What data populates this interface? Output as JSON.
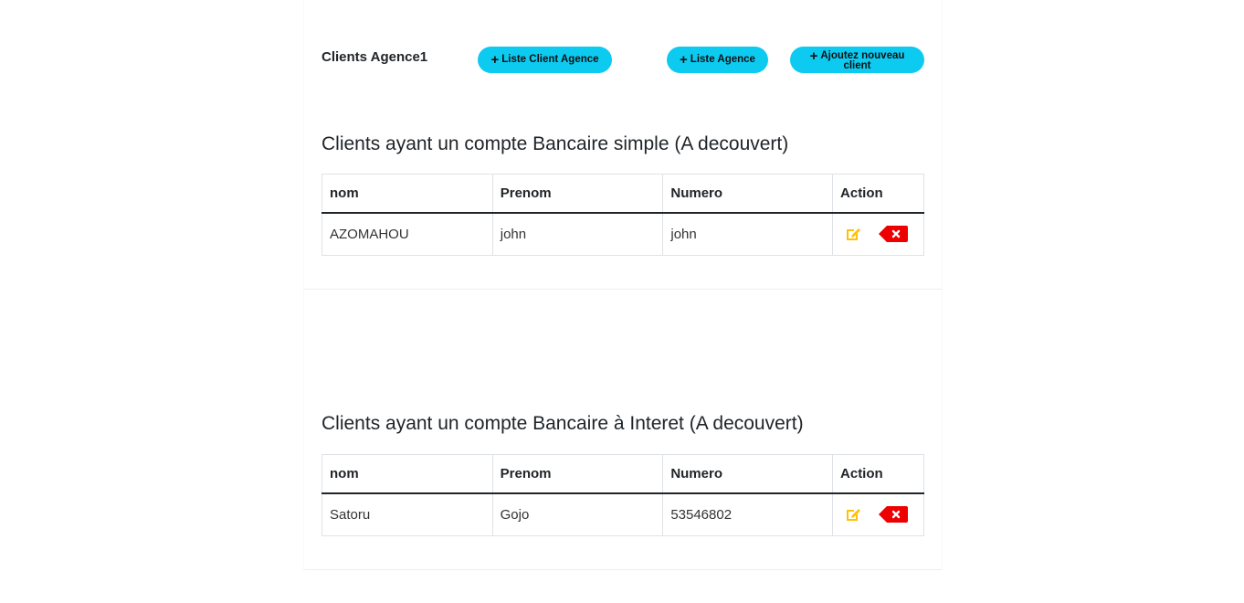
{
  "header": {
    "title": "Clients Agence1",
    "buttons": {
      "list_clients": "Liste Client Agence",
      "list_agence": "Liste Agence",
      "add_client_line1": "Ajoutez nouveau",
      "add_client_line2": "client"
    }
  },
  "sections": [
    {
      "title": "Clients ayant un compte Bancaire simple (A decouvert)",
      "columns": [
        "nom",
        "Prenom",
        "Numero",
        "Action"
      ],
      "rows": [
        {
          "nom": "AZOMAHOU",
          "prenom": "john",
          "numero": "john"
        }
      ]
    },
    {
      "title": "Clients ayant un compte Bancaire à Interet (A decouvert)",
      "columns": [
        "nom",
        "Prenom",
        "Numero",
        "Action"
      ],
      "rows": [
        {
          "nom": "Satoru",
          "prenom": "Gojo",
          "numero": "53546802"
        }
      ]
    }
  ],
  "colors": {
    "button": "#0dcaf0",
    "edit_icon": "#ffc107",
    "delete_icon": "#ee0000"
  },
  "icons": {
    "plus": "plus-icon",
    "edit": "edit-icon",
    "delete": "delete-icon"
  }
}
